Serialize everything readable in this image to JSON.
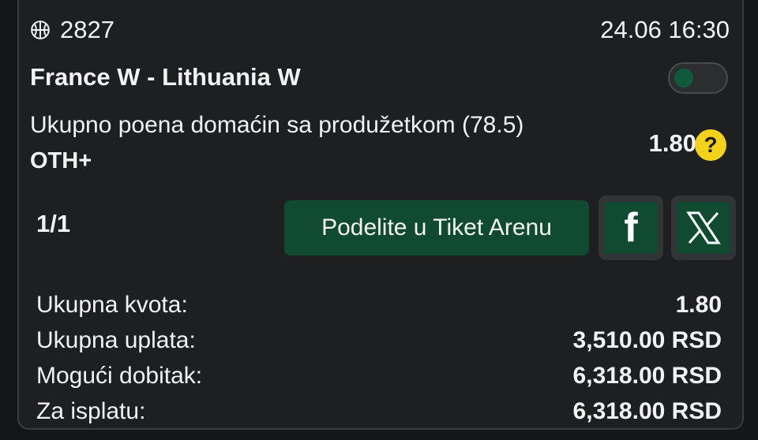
{
  "ticket": {
    "event_id": "2827",
    "sport_icon": "basketball-icon",
    "datetime": "24.06 16:30",
    "match": "France W - Lithuania W",
    "toggle_on": false,
    "market": "Ukupno poena domaćin sa produžetkom (78.5)",
    "pick": "OTH+",
    "odd": "1.80",
    "help_symbol": "?",
    "count": "1/1"
  },
  "share": {
    "label": "Podelite u Tiket Arenu",
    "facebook_glyph": "f",
    "x_icon": "x-logo-icon"
  },
  "summary": {
    "rows": [
      {
        "label": "Ukupna kvota:",
        "value": "1.80"
      },
      {
        "label": "Ukupna uplata:",
        "value": "3,510.00 RSD"
      },
      {
        "label": "Mogući dobitak:",
        "value": "6,318.00 RSD"
      },
      {
        "label": "Za isplatu:",
        "value": "6,318.00 RSD"
      }
    ]
  },
  "colors": {
    "background": "#1e1f21",
    "accent_green": "#0f4a31",
    "help_yellow": "#f3d21b"
  }
}
